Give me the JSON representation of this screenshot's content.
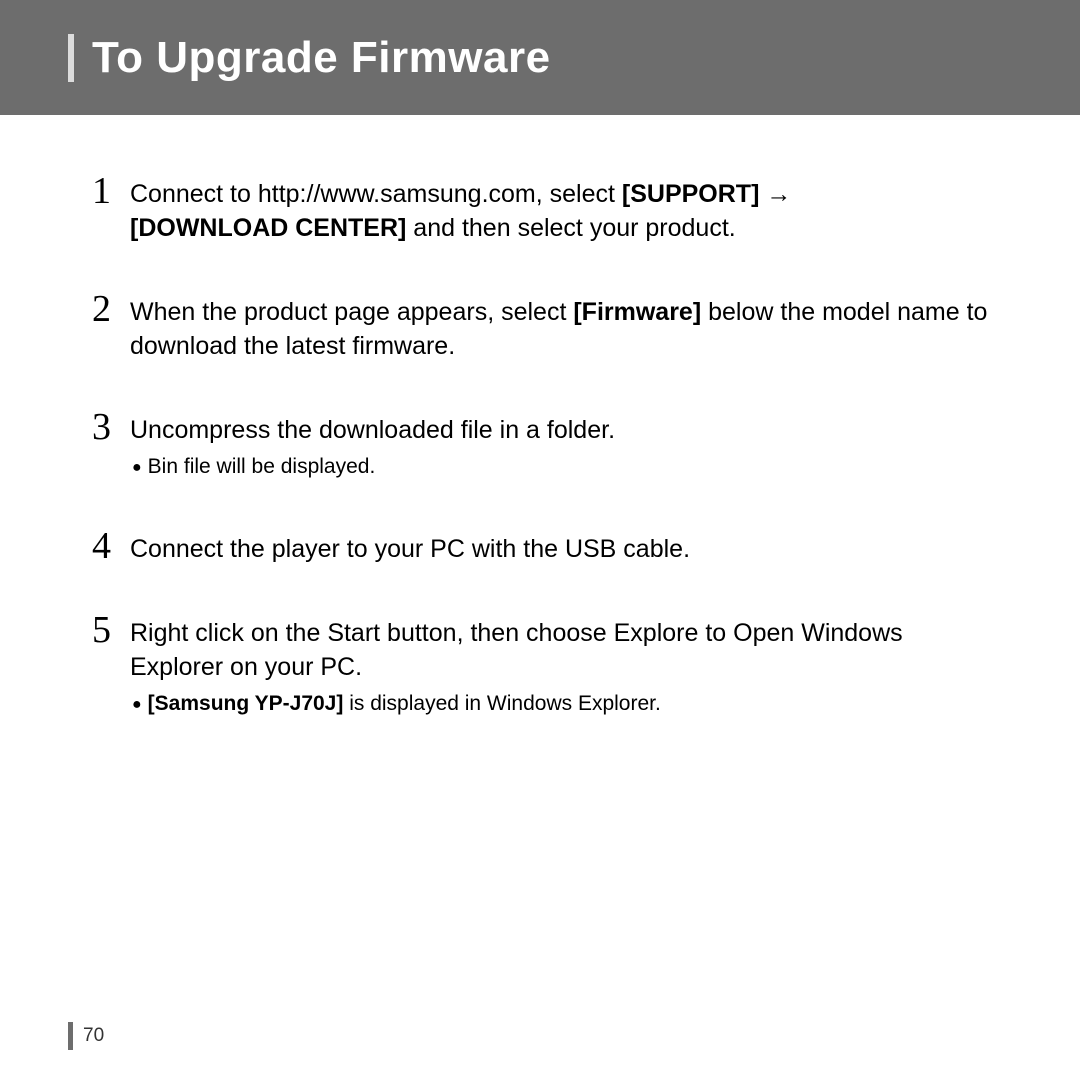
{
  "header": {
    "title": "To Upgrade Firmware"
  },
  "steps": {
    "s1": {
      "num": "1",
      "t1": "Connect to http://www.samsung.com, select ",
      "b1": "[SUPPORT]",
      "arrow": " → ",
      "b2": "[DOWNLOAD CENTER]",
      "t2": " and then select your product."
    },
    "s2": {
      "num": "2",
      "t1": "When the product page appears, select ",
      "b1": "[Firmware]",
      "t2": " below the model name to download the latest firmware."
    },
    "s3": {
      "num": "3",
      "t1": "Uncompress the downloaded file in a folder.",
      "sub": "Bin file will be displayed."
    },
    "s4": {
      "num": "4",
      "t1": "Connect the player to your PC with the USB cable."
    },
    "s5": {
      "num": "5",
      "t1": "Right click on the Start button, then choose Explore to Open Windows Explorer on your PC.",
      "sub_b": "[Samsung YP-J70J]",
      "sub_t": " is displayed in Windows Explorer."
    }
  },
  "page_number": "70"
}
